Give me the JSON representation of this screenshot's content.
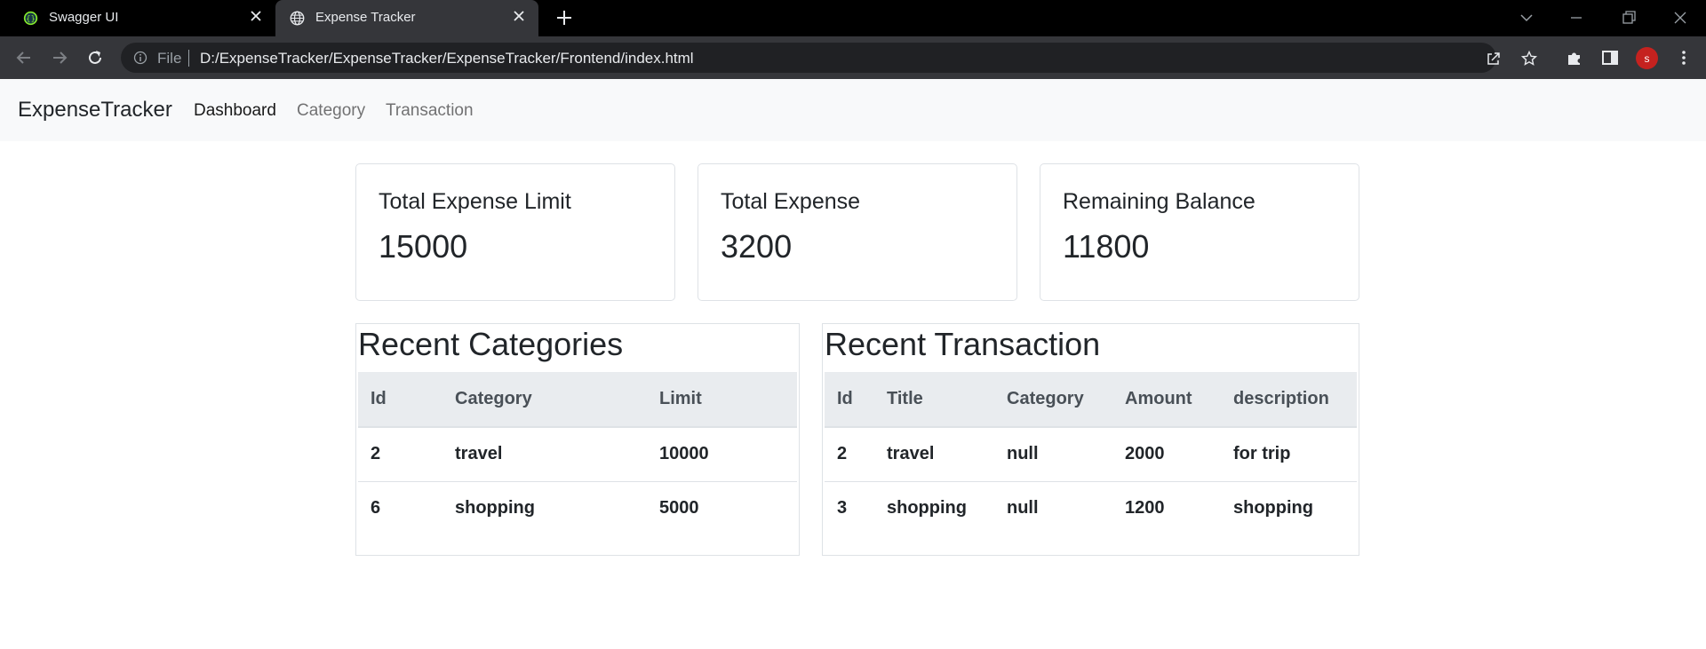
{
  "browser": {
    "tabs": [
      {
        "title": "Swagger UI",
        "icon": "swagger-icon",
        "active": false
      },
      {
        "title": "Expense Tracker",
        "icon": "globe-icon",
        "active": true
      }
    ],
    "address": {
      "scheme_label": "File",
      "url": "D:/ExpenseTracker/ExpenseTracker/ExpenseTracker/Frontend/index.html"
    },
    "profile_initial": "s"
  },
  "navbar": {
    "brand": "ExpenseTracker",
    "links": [
      {
        "label": "Dashboard",
        "active": true
      },
      {
        "label": "Category",
        "active": false
      },
      {
        "label": "Transaction",
        "active": false
      }
    ]
  },
  "cards": [
    {
      "title": "Total Expense Limit",
      "value": "15000"
    },
    {
      "title": "Total Expense",
      "value": "3200"
    },
    {
      "title": "Remaining Balance",
      "value": "11800"
    }
  ],
  "recent_categories": {
    "title": "Recent Categories",
    "columns": [
      "Id",
      "Category",
      "Limit"
    ],
    "rows": [
      [
        "2",
        "travel",
        "10000"
      ],
      [
        "6",
        "shopping",
        "5000"
      ]
    ]
  },
  "recent_transactions": {
    "title": "Recent Transaction",
    "columns": [
      "Id",
      "Title",
      "Category",
      "Amount",
      "description"
    ],
    "rows": [
      [
        "2",
        "travel",
        "null",
        "2000",
        "for trip"
      ],
      [
        "3",
        "shopping",
        "null",
        "1200",
        "shopping"
      ]
    ]
  },
  "colors": {
    "tabbar_bg": "#000000",
    "toolbar_bg": "#35363a",
    "navbar_bg": "#f8f9fa",
    "table_header_bg": "#e9ecef",
    "avatar_bg": "#c5221f"
  }
}
